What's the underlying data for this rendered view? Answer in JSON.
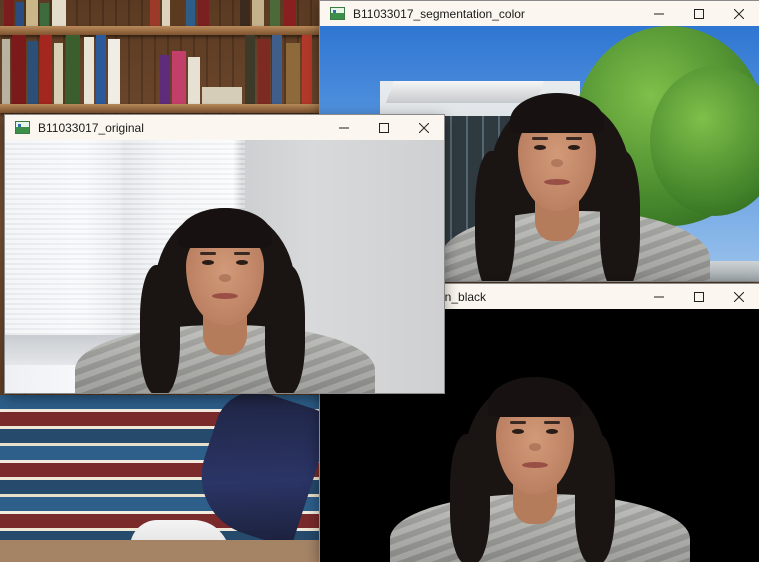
{
  "windows": {
    "original": {
      "title": "B11033017_original"
    },
    "segmentation_color": {
      "title": "B11033017_segmentation_color"
    },
    "segmentation_black": {
      "title_visible": "tion_black"
    }
  },
  "icons": {
    "app": "opencv-window-icon",
    "minimize": "minimize-icon",
    "maximize": "maximize-icon",
    "close": "close-icon"
  },
  "colors": {
    "titlebar": "#fbf6ef",
    "black_background": "#000000",
    "sky": "#2f76d2"
  }
}
